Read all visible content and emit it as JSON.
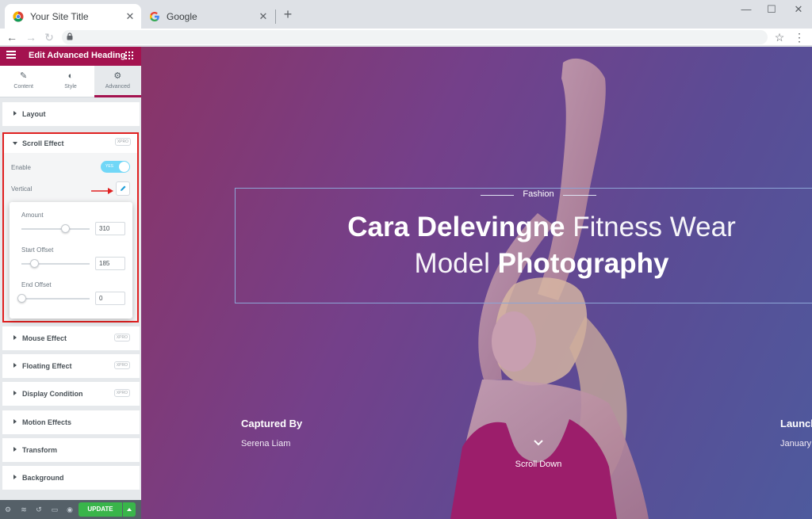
{
  "browser": {
    "tabs": [
      {
        "title": "Your Site Title",
        "active": true
      },
      {
        "title": "Google",
        "active": false
      }
    ],
    "new_tab": "+",
    "window_controls": {
      "minimize": "—",
      "maximize": "☐",
      "close": "✕"
    }
  },
  "panel": {
    "header_title": "Edit Advanced Heading",
    "tabs": [
      {
        "label": "Content",
        "icon": "pencil-icon"
      },
      {
        "label": "Style",
        "icon": "contrast-icon"
      },
      {
        "label": "Advanced",
        "icon": "gear-icon"
      }
    ],
    "sections": {
      "layout": "Layout",
      "scroll_effect": "Scroll Effect",
      "mouse_effect": "Mouse Effect",
      "floating_effect": "Floating Effect",
      "display_condition": "Display Condition",
      "motion_effects": "Motion Effects",
      "transform": "Transform",
      "background": "Background"
    },
    "pro_badge": "XPRO",
    "scroll_effect": {
      "enable_label": "Enable",
      "toggle_text": "YES",
      "toggle_on": true,
      "vertical_label": "Vertical",
      "amount_label": "Amount",
      "amount_value": "310",
      "start_offset_label": "Start Offset",
      "start_offset_value": "185",
      "end_offset_label": "End Offset",
      "end_offset_value": "0"
    },
    "footer": {
      "update_label": "UPDATE"
    },
    "colors": {
      "brand": "#a4124f",
      "update": "#39b54a",
      "annotation": "#e02020"
    }
  },
  "preview": {
    "eyebrow": "Fashion",
    "heading_line1_bold": "Cara Delevingne",
    "heading_line1_light": "Fitness Wear",
    "heading_line2_light": "Model",
    "heading_line2_bold": "Photography",
    "captured_by_label": "Captured By",
    "captured_by_name": "Serena Liam",
    "launch_label": "Launch",
    "launch_value": "January",
    "scroll_down": "Scroll Down"
  }
}
